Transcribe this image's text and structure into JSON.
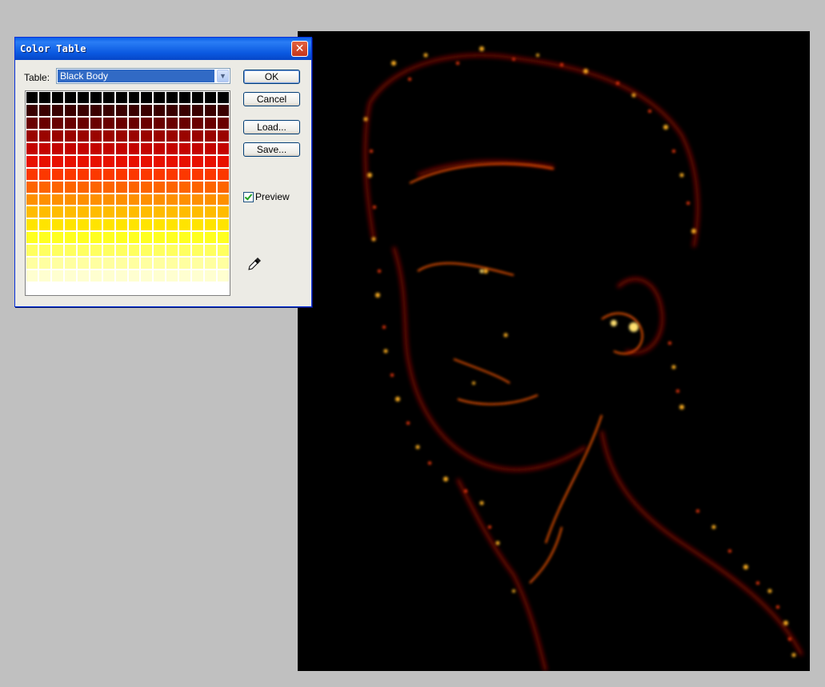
{
  "dialog": {
    "title": "Color Table",
    "table_label": "Table:",
    "table_value": "Black Body",
    "buttons": {
      "ok": "OK",
      "cancel": "Cancel",
      "load": "Load...",
      "save": "Save..."
    },
    "preview_label": "Preview",
    "preview_checked": true
  },
  "color_table": {
    "name": "Black Body",
    "rows": 16,
    "cols": 16,
    "row_colors": [
      "#000000",
      "#3a0000",
      "#6a0000",
      "#9a0400",
      "#c40400",
      "#e81000",
      "#fc3800",
      "#fd6400",
      "#fe9000",
      "#ffbc00",
      "#ffe400",
      "#ffff20",
      "#ffff60",
      "#ffffa0",
      "#ffffd0",
      "#ffffff"
    ]
  },
  "canvas": {
    "description_color": "#ff3000"
  }
}
